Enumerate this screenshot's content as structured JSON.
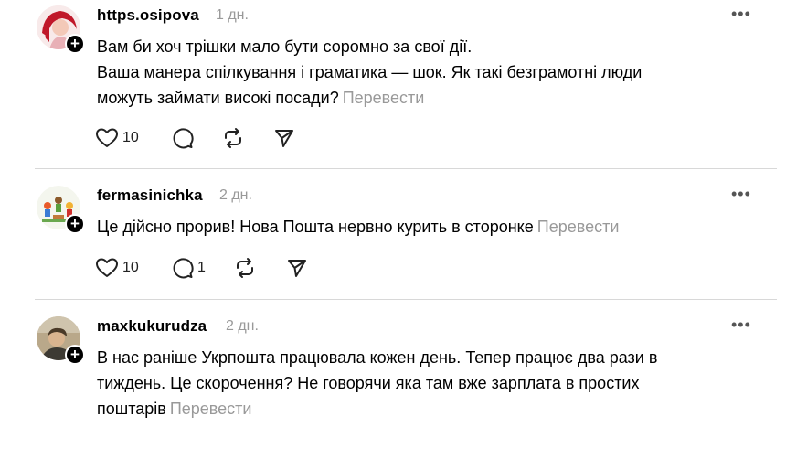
{
  "comments": [
    {
      "username": "https.osipova",
      "time": "1 дн.",
      "lines": [
        "Вам би хоч трішки мало бути соромно за свої дії.",
        "Ваша манера спілкування і граматика — шок. Як такі безграмотні люди",
        "можуть займати високі посади?"
      ],
      "translate_label": "Перевести",
      "likes": "10",
      "replies": ""
    },
    {
      "username": "fermasinichka",
      "time": "2 дн.",
      "lines": [
        "Це дійсно прорив! Нова Пошта нервно курить в сторонке"
      ],
      "translate_label": "Перевести",
      "likes": "10",
      "replies": "1"
    },
    {
      "username": "maxkukurudza",
      "time": "2 дн.",
      "lines": [
        "В нас раніше Укрпошта працювала кожен день. Тепер працює два рази в",
        "тиждень. Це скорочення? Не говорячи яка там вже зарплата в простих",
        "поштарів"
      ],
      "translate_label": "Перевести"
    }
  ],
  "follow_symbol": "+",
  "more_symbol": "•••",
  "icons": {
    "like": "heart-icon",
    "reply": "comment-icon",
    "repost": "repost-icon",
    "share": "send-icon"
  }
}
